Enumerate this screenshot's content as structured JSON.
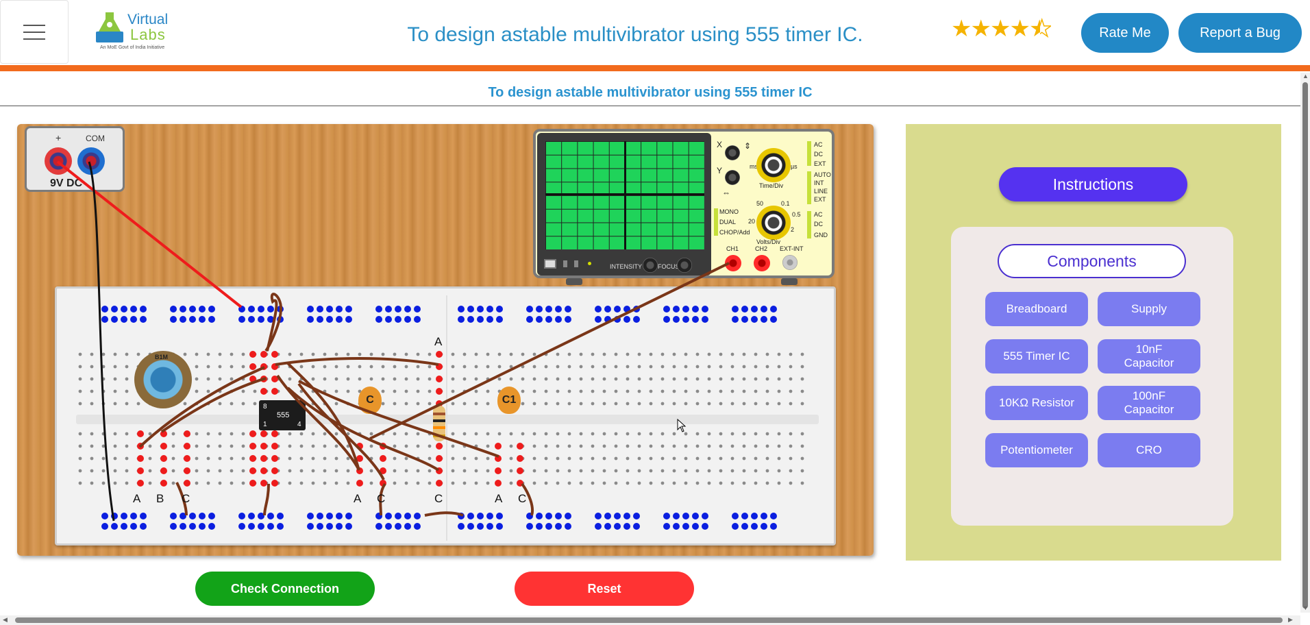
{
  "header": {
    "menu_icon": "hamburger-menu-icon",
    "logo": {
      "line1": "Virtual",
      "line2": "Labs",
      "tagline": "An MoE Govt of India Initiative"
    },
    "title": "To design astable multivibrator using 555 timer IC.",
    "rating": {
      "stars_filled": 4,
      "stars_half": 1,
      "value": 4.5,
      "color": "#f5b301"
    },
    "rate_label": "Rate Me",
    "bug_label": "Report a Bug",
    "accent": "#f26b1d"
  },
  "subtitle": "To design astable multivibrator using 555 timer IC",
  "workbench": {
    "supply": {
      "plus": "+",
      "com": "COM",
      "label": "9V DC"
    },
    "cro": {
      "x": "X",
      "y": "Y",
      "ms": "ms",
      "us": "µs",
      "time_div": "Time/Div",
      "volts_div": "Volts/Div",
      "v50": "50",
      "v01": "0.1",
      "v20": "20",
      "v05": "0.5",
      "v2": "2",
      "mode": [
        "MONO",
        "DUAL",
        "CHOP/Add"
      ],
      "coupling1": [
        "AC",
        "DC",
        "EXT"
      ],
      "trigger": [
        "AUTO",
        "INT",
        "LINE",
        "EXT"
      ],
      "coupling2": [
        "AC",
        "DC",
        "GND"
      ],
      "ch1": "CH1",
      "ch2": "CH2",
      "ext": "EXT-INT",
      "intensity": "INTENSITY",
      "focus": "FOCUS"
    },
    "pot_label": "B1M",
    "ic": {
      "pin8": "8",
      "name": "555",
      "pin1": "1",
      "pin4": "4"
    },
    "cap_c": "C",
    "cap_c1": "C1",
    "labels": [
      "A",
      "B",
      "C",
      "A",
      "C",
      "C",
      "A",
      "C",
      "A"
    ]
  },
  "actions": {
    "check": "Check Connection",
    "reset": "Reset"
  },
  "panel": {
    "instructions": "Instructions",
    "components": "Components",
    "items": [
      "Breadboard",
      "Supply",
      "555 Timer IC",
      "10nF\nCapacitor",
      "10KΩ Resistor",
      "100nF\nCapacitor",
      "Potentiometer",
      "CRO"
    ]
  }
}
